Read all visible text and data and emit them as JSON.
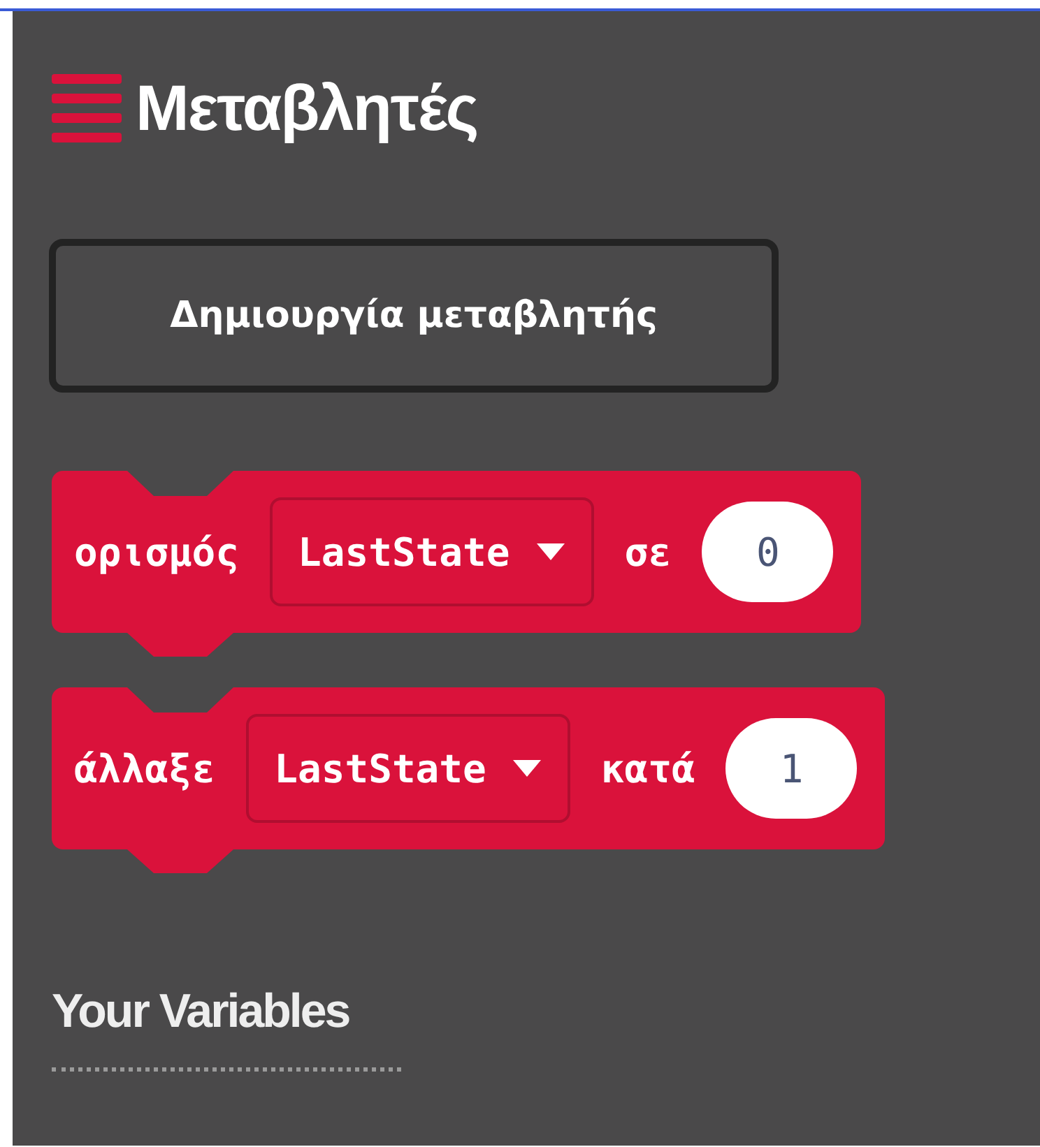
{
  "panel": {
    "title": "Μεταβλητές"
  },
  "create_button": {
    "label": "Δημιουργία μεταβλητής"
  },
  "blocks": [
    {
      "label": "ορισμός",
      "variable": "LastState",
      "connector": "σε",
      "value": "0"
    },
    {
      "label": "άλλαξε",
      "variable": "LastState",
      "connector": "κατά",
      "value": "1"
    }
  ],
  "section": {
    "title": "Your Variables"
  }
}
